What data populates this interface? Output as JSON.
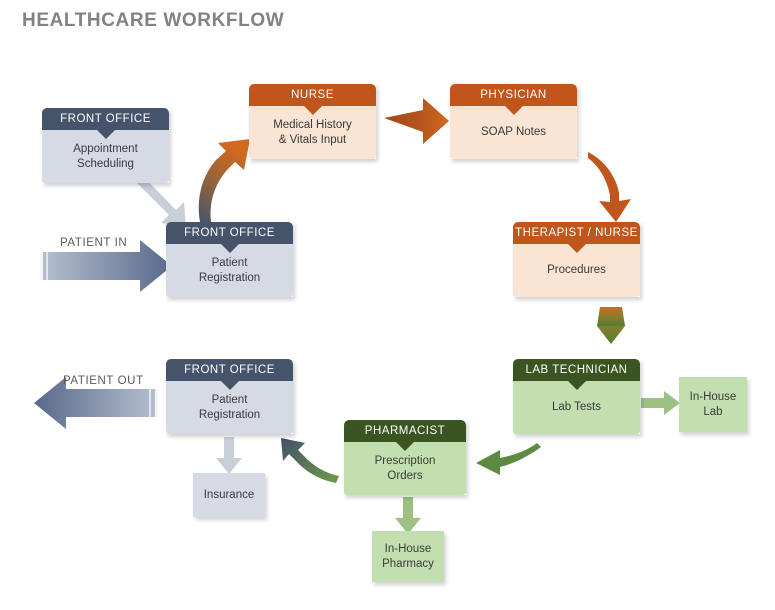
{
  "title": "HEALTHCARE WORKFLOW",
  "colors": {
    "title_text": "#808285",
    "navy_header": "#46546b",
    "navy_body": "#d5dae4",
    "orange_header": "#c0561b",
    "orange_body": "#fae4d4",
    "green_header": "#3a5522",
    "green_body": "#c3dfb0",
    "green_arrow": "#5c8a3f",
    "gray_arrow": "#c9cfd9"
  },
  "nodes": [
    {
      "id": "appointment-scheduling",
      "header": "FRONT OFFICE",
      "body": "Appointment\nScheduling",
      "theme": "navy"
    },
    {
      "id": "nurse-vitals",
      "header": "NURSE",
      "body": "Medical History\n& Vitals Input",
      "theme": "orange"
    },
    {
      "id": "physician-soap",
      "header": "PHYSICIAN",
      "body": "SOAP Notes",
      "theme": "orange"
    },
    {
      "id": "patient-registration-in",
      "header": "FRONT OFFICE",
      "body": "Patient\nRegistration",
      "theme": "navy"
    },
    {
      "id": "therapist-procedures",
      "header": "THERAPIST / NURSE",
      "body": "Procedures",
      "theme": "orange"
    },
    {
      "id": "lab-technician-tests",
      "header": "LAB TECHNICIAN",
      "body": "Lab Tests",
      "theme": "green"
    },
    {
      "id": "patient-registration-out",
      "header": "FRONT OFFICE",
      "body": "Patient\nRegistration",
      "theme": "navy"
    },
    {
      "id": "pharmacist-orders",
      "header": "PHARMACIST",
      "body": "Prescription\nOrders",
      "theme": "green"
    }
  ],
  "plain_boxes": [
    {
      "id": "in-house-lab",
      "label": "In-House\nLab",
      "theme": "green"
    },
    {
      "id": "insurance",
      "label": "Insurance",
      "theme": "navy"
    },
    {
      "id": "in-house-pharmacy",
      "label": "In-House\nPharmacy",
      "theme": "green"
    }
  ],
  "flow_labels": {
    "patient_in": "PATIENT IN",
    "patient_out": "PATIENT OUT"
  },
  "chart_data": {
    "type": "diagram",
    "title": "HEALTHCARE WORKFLOW",
    "nodes": [
      {
        "role": "FRONT OFFICE",
        "task": "Appointment Scheduling"
      },
      {
        "role": "FRONT OFFICE",
        "task": "Patient Registration"
      },
      {
        "role": "NURSE",
        "task": "Medical History & Vitals Input"
      },
      {
        "role": "PHYSICIAN",
        "task": "SOAP Notes"
      },
      {
        "role": "THERAPIST / NURSE",
        "task": "Procedures"
      },
      {
        "role": "LAB TECHNICIAN",
        "task": "Lab Tests"
      },
      {
        "role": "",
        "task": "In-House Lab"
      },
      {
        "role": "PHARMACIST",
        "task": "Prescription Orders"
      },
      {
        "role": "",
        "task": "In-House Pharmacy"
      },
      {
        "role": "FRONT OFFICE",
        "task": "Patient Registration"
      },
      {
        "role": "",
        "task": "Insurance"
      }
    ],
    "edges": [
      {
        "from": "PATIENT IN",
        "to": "Patient Registration"
      },
      {
        "from": "Appointment Scheduling",
        "to": "Patient Registration"
      },
      {
        "from": "Patient Registration",
        "to": "Medical History & Vitals Input"
      },
      {
        "from": "Medical History & Vitals Input",
        "to": "SOAP Notes"
      },
      {
        "from": "SOAP Notes",
        "to": "Procedures"
      },
      {
        "from": "Procedures",
        "to": "Lab Tests"
      },
      {
        "from": "Lab Tests",
        "to": "In-House Lab"
      },
      {
        "from": "Lab Tests",
        "to": "Prescription Orders"
      },
      {
        "from": "Prescription Orders",
        "to": "In-House Pharmacy"
      },
      {
        "from": "Prescription Orders",
        "to": "Patient Registration"
      },
      {
        "from": "Patient Registration",
        "to": "Insurance"
      },
      {
        "from": "Patient Registration",
        "to": "PATIENT OUT"
      }
    ]
  }
}
